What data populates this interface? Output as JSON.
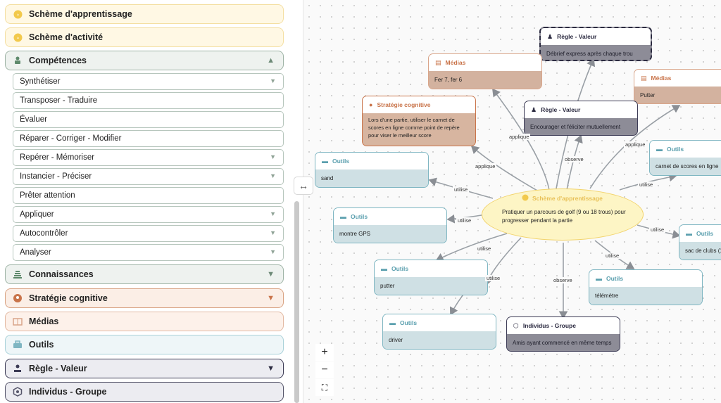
{
  "sidebar": {
    "categories": [
      {
        "label": "Schème d'apprentissage",
        "icon": "scheme-learning-icon"
      },
      {
        "label": "Schème d'activité",
        "icon": "scheme-activity-icon"
      },
      {
        "label": "Compétences",
        "icon": "competence-icon",
        "arrow": "▲"
      },
      {
        "label": "Connaissances",
        "icon": "books-icon",
        "arrow": "▼"
      },
      {
        "label": "Stratégie cognitive",
        "icon": "head-icon",
        "arrow": "▼"
      },
      {
        "label": "Médias",
        "icon": "media-icon"
      },
      {
        "label": "Outils",
        "icon": "tools-icon"
      },
      {
        "label": "Règle - Valeur",
        "icon": "rule-icon",
        "arrow": "▼"
      },
      {
        "label": "Individus - Groupe",
        "icon": "group-icon"
      }
    ],
    "competences": [
      {
        "label": "Synthétiser",
        "arrow": "▼"
      },
      {
        "label": "Transposer - Traduire"
      },
      {
        "label": "Évaluer"
      },
      {
        "label": "Réparer - Corriger - Modifier"
      },
      {
        "label": "Repérer - Mémoriser",
        "arrow": "▼"
      },
      {
        "label": "Instancier - Préciser",
        "arrow": "▼"
      },
      {
        "label": "Prêter attention"
      },
      {
        "label": "Appliquer",
        "arrow": "▼"
      },
      {
        "label": "Autocontrôler",
        "arrow": "▼"
      },
      {
        "label": "Analyser",
        "arrow": "▼"
      }
    ]
  },
  "canvas": {
    "center": {
      "title": "Schème d'apprentissage",
      "text": "Pratiquer un parcours de golf (9 ou 18 trous) pour progresser pendant la partie"
    },
    "nodes": {
      "regle_top": {
        "title": "Règle - Valeur",
        "text": "Débrief express après chaque trou"
      },
      "medias1": {
        "title": "Médias",
        "text": "Fer 7, fer 6"
      },
      "medias2": {
        "title": "Médias",
        "text": "Putter"
      },
      "strategie": {
        "title": "Stratégie cognitive",
        "text": "Lors d'une partie, utiliser le carnet de scores en ligne comme point de repère pour viser le meilleur score"
      },
      "regle_mid": {
        "title": "Règle - Valeur",
        "text": "Encourager et féliciter mutuellement"
      },
      "outils_sand": {
        "title": "Outils",
        "text": "sand"
      },
      "outils_carnet": {
        "title": "Outils",
        "text": "carnet de scores en ligne"
      },
      "outils_gps": {
        "title": "Outils",
        "text": "montre GPS"
      },
      "outils_sac": {
        "title": "Outils",
        "text": "sac de clubs (1"
      },
      "outils_putter": {
        "title": "Outils",
        "text": "putter"
      },
      "outils_telemetre": {
        "title": "Outils",
        "text": "télémètre"
      },
      "outils_driver": {
        "title": "Outils",
        "text": "driver"
      },
      "individus": {
        "title": "Individus - Groupe",
        "text": "Amis ayant commencé en même temps"
      }
    },
    "edge_labels": {
      "applique1": "applique",
      "applique2": "applique",
      "applique3": "applique",
      "observe1": "observe",
      "observe2": "observe",
      "utilise1": "utilise",
      "utilise2": "utilise",
      "utilise3": "utilise",
      "utilise4": "utilise",
      "utilise5": "utilise",
      "utilise6": "utilise",
      "utilise7": "utilise"
    }
  },
  "controls": {
    "zoom_in": "+",
    "zoom_out": "−",
    "fit": "⛶",
    "resize": "↔"
  },
  "colors": {
    "scheme": "#f2c94c",
    "competences": "#7a9c86",
    "strategie": "#c9744a",
    "medias": "#d9a58a",
    "outils": "#7fb6c2",
    "regle": "#3c3b55",
    "individus": "#555566"
  }
}
